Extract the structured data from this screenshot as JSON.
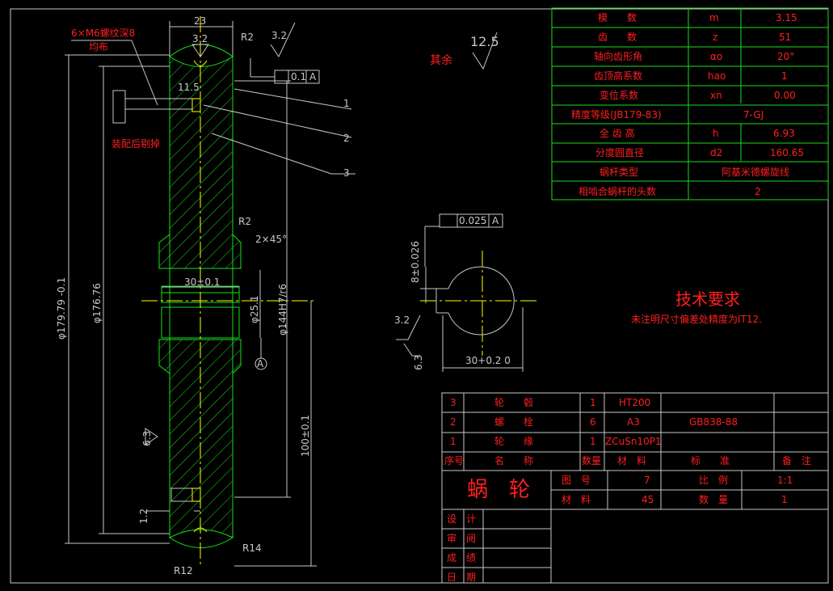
{
  "colors": {
    "background": "#000000",
    "border": "#c8c8c8",
    "red": "#ff1f1f",
    "green": "#18e018",
    "white": "#ffffff",
    "yellow": "#ffff00",
    "cyan": "#00e5e5"
  },
  "params": [
    {
      "name": "模　　数",
      "sym": "m",
      "val": "3.15"
    },
    {
      "name": "齿　　数",
      "sym": "z",
      "val": "51"
    },
    {
      "name": "轴向齿形角",
      "sym": "αo",
      "val": "20°"
    },
    {
      "name": "齿顶高系数",
      "sym": "hao",
      "val": "1"
    },
    {
      "name": "变位系数",
      "sym": "xn",
      "val": "0.00"
    },
    {
      "name": "精度等级(JB179-83)",
      "sym": "",
      "val": "7-GJ"
    },
    {
      "name": "全 齿 高",
      "sym": "h",
      "val": "6.93"
    },
    {
      "name": "分度圆直径",
      "sym": "d2",
      "val": "160.65"
    },
    {
      "name": "蜗杆类型",
      "sym": "",
      "val": "阿基米德螺旋线"
    },
    {
      "name": "相啮合蜗杆的头数",
      "sym": "",
      "val": "2"
    }
  ],
  "bom": {
    "rows": [
      {
        "no": "3",
        "name": "轮　　毂",
        "qty": "1",
        "mat": "HT200",
        "std": ""
      },
      {
        "no": "2",
        "name": "螺　　栓",
        "qty": "6",
        "mat": "A3",
        "std": "GB838-88"
      },
      {
        "no": "1",
        "name": "轮　　缘",
        "qty": "1",
        "mat": "ZCuSn10P1",
        "std": ""
      }
    ],
    "header": {
      "no": "序号",
      "name": "名　　称",
      "qty": "数量",
      "mat": "材　料",
      "std": "标　　准",
      "note": "备　注"
    }
  },
  "titleblock": {
    "title": "蜗　轮",
    "drawing_no_label": "图　号",
    "drawing_no": "7",
    "scale_label": "比　例",
    "scale": "1:1",
    "material_label": "材　料",
    "material": "45",
    "qty_label": "数　量",
    "qty": "1",
    "sign_rows": [
      "设　计",
      "审　阅",
      "成　绩",
      "日　期"
    ]
  },
  "tech": {
    "title": "技术要求",
    "note": "未注明尺寸偏差处精度为IT12."
  },
  "roughness": {
    "other": "其余",
    "main": "12.5"
  },
  "annotations": {
    "dim_23": "23",
    "rough_32a": "3.2",
    "r2_top": "R2",
    "rough_32b": "3.2",
    "tol_runout": "0.1",
    "datum_a": "A",
    "bolt_note1": "6×M6螺纹深8",
    "bolt_note2": "均布",
    "dim_115": "11.5",
    "remove_note": "装配后剔掉",
    "r2_mid": "R2",
    "chamfer": "2×45°",
    "dim_30": "30±0.1",
    "dim_25": "φ25.1",
    "dim_144": "φ144H7/r6",
    "dim_179": "φ179.79 -0.1",
    "dim_176": "φ176.76",
    "dim_100": "100±0.1",
    "rough_63": "6.3",
    "dim_12": "1.2",
    "r14": "R14",
    "r12": "R12",
    "leader1": "1",
    "leader2": "2",
    "leader3": "3",
    "datum_circle": "A",
    "sym_tol": "0.025",
    "sym_datum": "A",
    "dim_8": "8±0.026",
    "rough_32c": "3.2",
    "rough_63b": "6.3",
    "dim_30b": "30+0.2 0"
  }
}
